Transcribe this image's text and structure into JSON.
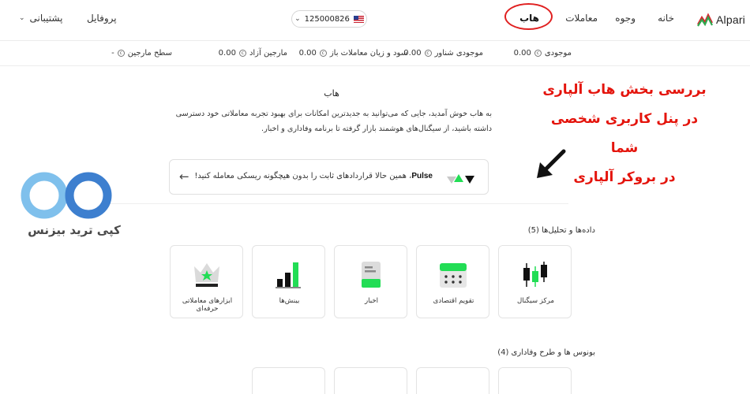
{
  "brand": {
    "name": "Alpari",
    "icon": "alpari-logo-icon"
  },
  "nav": {
    "home": "خانه",
    "funds": "وجوه",
    "trades": "معاملات",
    "hub": "هاب",
    "profile": "پروفایل",
    "support": "پشتیبانی"
  },
  "account": {
    "number": "125000826",
    "flag_icon": "us-flag-icon"
  },
  "balances": [
    {
      "label": "موجودی",
      "value": "0.00"
    },
    {
      "label": "موجودی شناور",
      "value": "0.00"
    },
    {
      "label": "سود و زیان معاملات باز",
      "value": "0.00"
    },
    {
      "label": "مارجین آزاد",
      "value": "0.00"
    },
    {
      "label": "سطح مارجین",
      "value": "-"
    }
  ],
  "hub": {
    "title": "هاب",
    "description": "به هاب خوش آمدید، جایی که می‌توانید به جدیدترین امکانات برای بهبود تجربه معاملاتی خود دسترسی داشته باشید، از سیگنال‌های هوشمند بازار گرفته تا برنامه وفاداری و اخبار."
  },
  "pulse": {
    "brand": "Pulse",
    "text": "، همین حالا قراردادهای ثابت را بدون هیچگونه ریسکی معامله کنید!"
  },
  "annotation": {
    "lines": [
      "بررسی بخش هاب آلپاری",
      "در پنل کاربری شخصی شما",
      "در بروکر آلپاری"
    ],
    "color": "#e4140c"
  },
  "watermark": {
    "text": "کپی ترید بیزنس"
  },
  "sections": {
    "data_analysis": {
      "title": "داده‌ها و تحلیل‌ها (5)",
      "items": [
        {
          "label": "مرکز سیگنال",
          "icon": "candlestick-icon"
        },
        {
          "label": "تقویم اقتصادی",
          "icon": "calendar-icon"
        },
        {
          "label": "اخبار",
          "icon": "news-icon"
        },
        {
          "label": "بینش‌ها",
          "icon": "bar-chart-icon"
        },
        {
          "label": "ابزارهای معاملاتی حرفه‌ای",
          "icon": "crown-icon"
        }
      ]
    },
    "bonus": {
      "title": "بونوس ها و طرح وفاداری (4)"
    }
  },
  "colors": {
    "accent_green": "#22dd55",
    "hub_highlight": "#e02020"
  }
}
